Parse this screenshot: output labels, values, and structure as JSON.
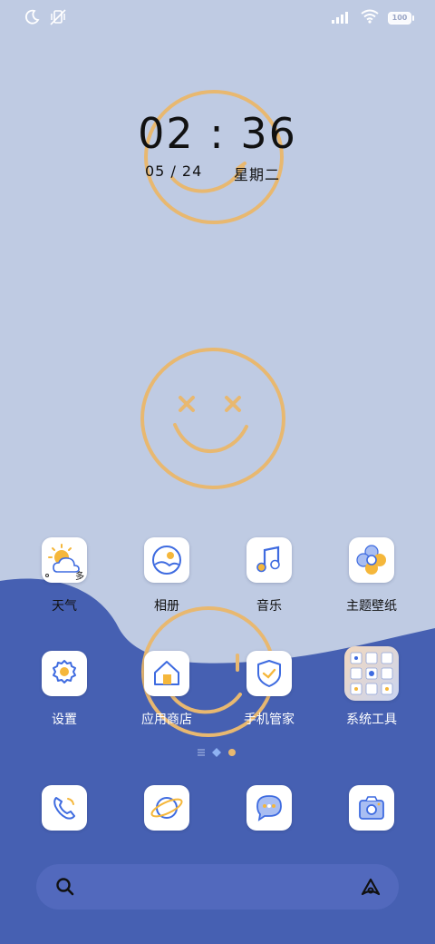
{
  "status_bar": {
    "battery_level": "100",
    "icons": [
      "moon-icon",
      "vibrate-off-icon",
      "signal-icon",
      "wifi-icon",
      "battery-icon"
    ]
  },
  "clock": {
    "time": "02 : 36",
    "date": "05 / 24",
    "weekday": "星期二"
  },
  "apps_row1": [
    {
      "label": "天气",
      "icon": "weather-icon",
      "badge": "多"
    },
    {
      "label": "相册",
      "icon": "gallery-icon"
    },
    {
      "label": "音乐",
      "icon": "music-icon"
    },
    {
      "label": "主题壁纸",
      "icon": "theme-icon"
    }
  ],
  "apps_row2": [
    {
      "label": "设置",
      "icon": "settings-icon"
    },
    {
      "label": "应用商店",
      "icon": "app-store-icon"
    },
    {
      "label": "手机管家",
      "icon": "security-icon"
    },
    {
      "label": "系统工具",
      "icon": "system-tools-folder-icon"
    }
  ],
  "dock": [
    {
      "icon": "phone-icon"
    },
    {
      "icon": "browser-icon"
    },
    {
      "icon": "messages-icon"
    },
    {
      "icon": "camera-icon"
    }
  ],
  "search": {
    "placeholder": ""
  },
  "colors": {
    "wallpaper_top": "#BFCBE3",
    "wallpaper_bottom": "#4660B2",
    "smiley": "#E8B870",
    "icon_accent": "#3E6BE0",
    "icon_yellow": "#F5B73B"
  }
}
